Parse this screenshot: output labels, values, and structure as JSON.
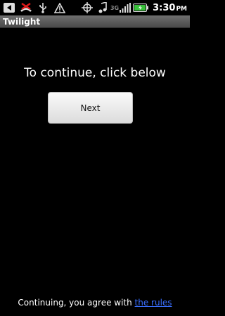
{
  "status_bar": {
    "time": "3:30",
    "time_suffix": "PM",
    "network_label": "3G",
    "icons": [
      "back-icon",
      "missed-call-icon",
      "usb-icon",
      "warning-icon",
      "gps-icon",
      "music-icon",
      "signal-icon",
      "battery-icon"
    ]
  },
  "title_bar": {
    "title": "Twilight"
  },
  "main": {
    "prompt": "To continue, click below",
    "next_label": "Next"
  },
  "footer": {
    "text": "Continuing, you agree with ",
    "link_label": "the rules"
  },
  "colors": {
    "background": "#000000",
    "link": "#3a6fff",
    "battery": "#38c03a"
  }
}
